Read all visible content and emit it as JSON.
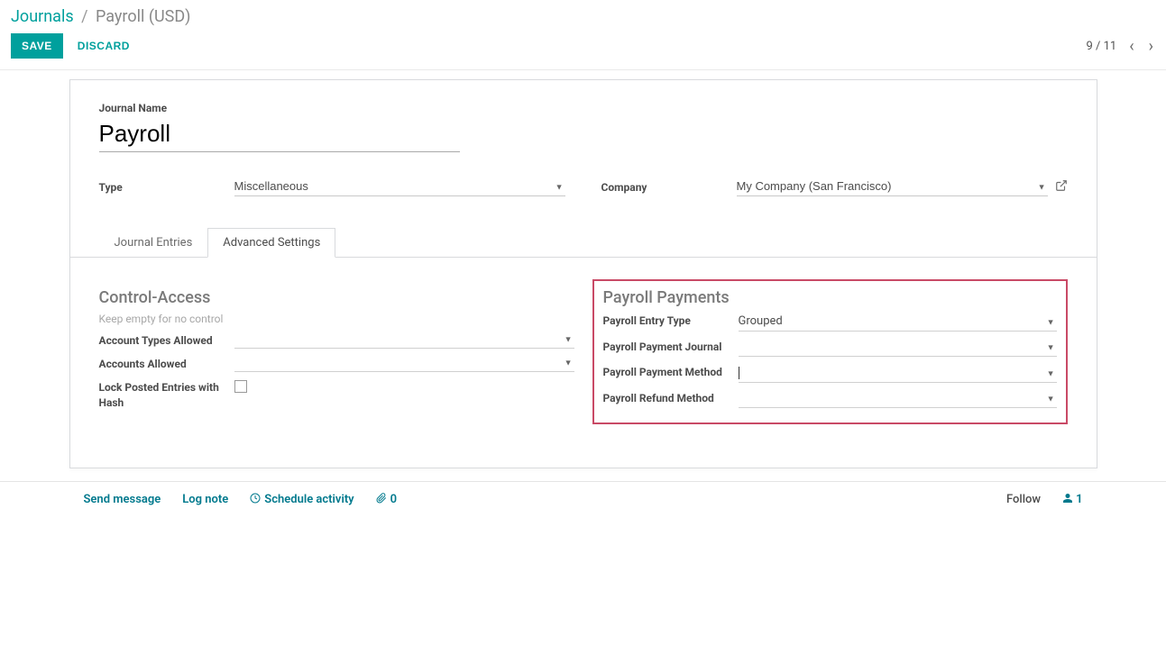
{
  "breadcrumb": {
    "root": "Journals",
    "current": "Payroll (USD)"
  },
  "toolbar": {
    "save": "SAVE",
    "discard": "DISCARD",
    "pager": "9 / 11"
  },
  "form": {
    "journal_name_label": "Journal Name",
    "journal_name_value": "Payroll",
    "type_label": "Type",
    "type_value": "Miscellaneous",
    "company_label": "Company",
    "company_value": "My Company (San Francisco)"
  },
  "tabs": {
    "journal_entries": "Journal Entries",
    "advanced_settings": "Advanced Settings"
  },
  "control_access": {
    "title": "Control-Access",
    "hint": "Keep empty for no control",
    "account_types_label": "Account Types Allowed",
    "accounts_label": "Accounts Allowed",
    "lock_label": "Lock Posted Entries with Hash"
  },
  "payroll": {
    "title": "Payroll Payments",
    "entry_type_label": "Payroll Entry Type",
    "entry_type_value": "Grouped",
    "payment_journal_label": "Payroll Payment Journal",
    "payment_method_label": "Payroll Payment Method",
    "refund_method_label": "Payroll Refund Method"
  },
  "footer": {
    "send_message": "Send message",
    "log_note": "Log note",
    "schedule_activity": "Schedule activity",
    "attach_count": "0",
    "follow": "Follow",
    "followers": "1"
  }
}
